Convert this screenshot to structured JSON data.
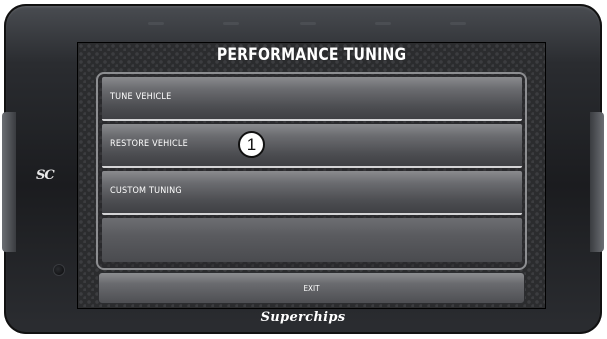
{
  "screen": {
    "title": "PERFORMANCE TUNING",
    "menu_items": [
      {
        "label": "TUNE VEHICLE"
      },
      {
        "label": "RESTORE VEHICLE"
      },
      {
        "label": "CUSTOM TUNING"
      },
      {
        "label": ""
      }
    ],
    "exit_label": "EXIT"
  },
  "annotation": {
    "callout_number": "1"
  },
  "device": {
    "badge_logo": "SC",
    "brand": "Superchips"
  },
  "colors": {
    "housing": "#1b1c1f",
    "screen_bg": "#2b2c2e",
    "menu_button": "#6b6c70",
    "text": "#ffffff"
  }
}
